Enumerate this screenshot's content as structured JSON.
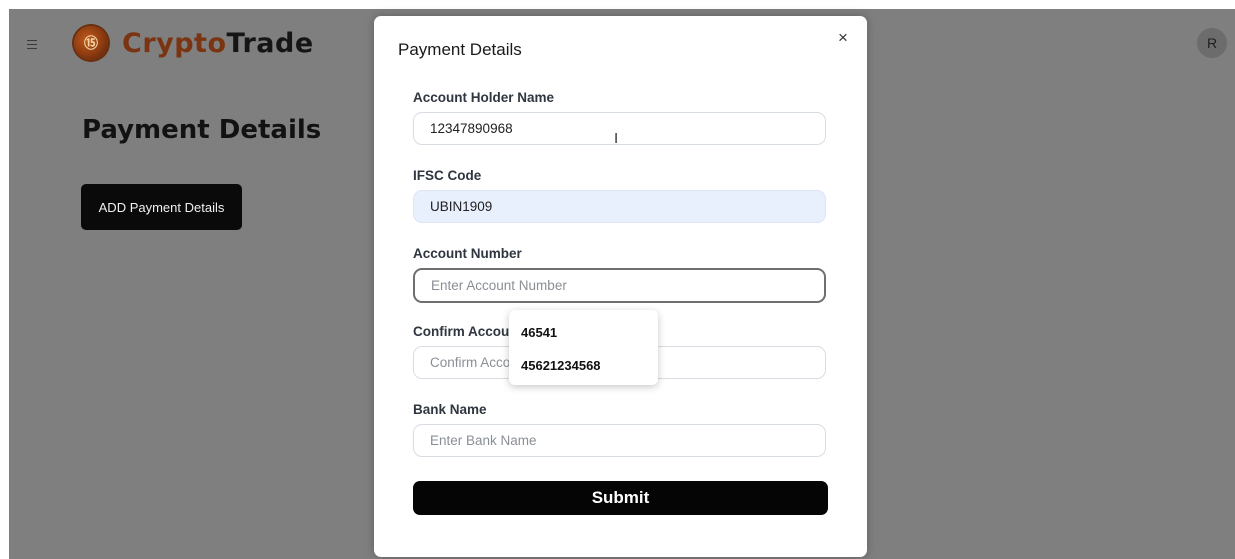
{
  "header": {
    "brand_first": "Crypto",
    "brand_second": "Trade",
    "logo_glyph": "⑮",
    "avatar_initial": "R",
    "menu_icon": "hamburger-icon"
  },
  "page": {
    "title": "Payment Details",
    "add_button_label": "ADD Payment Details"
  },
  "modal": {
    "title": "Payment Details",
    "close_glyph": "×",
    "fields": [
      {
        "label": "Account Holder Name",
        "value": "12347890968",
        "placeholder": ""
      },
      {
        "label": "IFSC Code",
        "value": "UBIN1909",
        "placeholder": ""
      },
      {
        "label": "Account Number",
        "value": "",
        "placeholder": "Enter Account Number"
      },
      {
        "label": "Confirm Account Number",
        "value": "",
        "placeholder": "Confirm Account Number"
      },
      {
        "label": "Bank Name",
        "value": "",
        "placeholder": "Enter Bank Name"
      }
    ],
    "autocomplete_suggestions": [
      "46541",
      "45621234568"
    ],
    "submit_label": "Submit"
  },
  "colors": {
    "overlay_bg": "#7f7f7f",
    "brand_accent": "#7a3412",
    "autofill_bg": "#e8effd",
    "button_bg": "#050505"
  }
}
